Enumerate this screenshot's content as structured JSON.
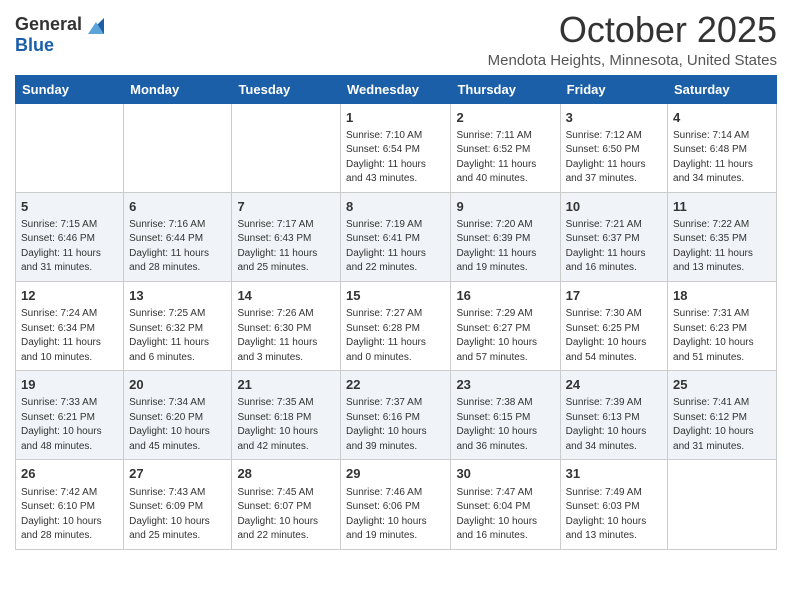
{
  "header": {
    "logo_general": "General",
    "logo_blue": "Blue",
    "month_title": "October 2025",
    "location": "Mendota Heights, Minnesota, United States"
  },
  "days_of_week": [
    "Sunday",
    "Monday",
    "Tuesday",
    "Wednesday",
    "Thursday",
    "Friday",
    "Saturday"
  ],
  "weeks": [
    [
      {
        "day": "",
        "info": ""
      },
      {
        "day": "",
        "info": ""
      },
      {
        "day": "",
        "info": ""
      },
      {
        "day": "1",
        "info": "Sunrise: 7:10 AM\nSunset: 6:54 PM\nDaylight: 11 hours\nand 43 minutes."
      },
      {
        "day": "2",
        "info": "Sunrise: 7:11 AM\nSunset: 6:52 PM\nDaylight: 11 hours\nand 40 minutes."
      },
      {
        "day": "3",
        "info": "Sunrise: 7:12 AM\nSunset: 6:50 PM\nDaylight: 11 hours\nand 37 minutes."
      },
      {
        "day": "4",
        "info": "Sunrise: 7:14 AM\nSunset: 6:48 PM\nDaylight: 11 hours\nand 34 minutes."
      }
    ],
    [
      {
        "day": "5",
        "info": "Sunrise: 7:15 AM\nSunset: 6:46 PM\nDaylight: 11 hours\nand 31 minutes."
      },
      {
        "day": "6",
        "info": "Sunrise: 7:16 AM\nSunset: 6:44 PM\nDaylight: 11 hours\nand 28 minutes."
      },
      {
        "day": "7",
        "info": "Sunrise: 7:17 AM\nSunset: 6:43 PM\nDaylight: 11 hours\nand 25 minutes."
      },
      {
        "day": "8",
        "info": "Sunrise: 7:19 AM\nSunset: 6:41 PM\nDaylight: 11 hours\nand 22 minutes."
      },
      {
        "day": "9",
        "info": "Sunrise: 7:20 AM\nSunset: 6:39 PM\nDaylight: 11 hours\nand 19 minutes."
      },
      {
        "day": "10",
        "info": "Sunrise: 7:21 AM\nSunset: 6:37 PM\nDaylight: 11 hours\nand 16 minutes."
      },
      {
        "day": "11",
        "info": "Sunrise: 7:22 AM\nSunset: 6:35 PM\nDaylight: 11 hours\nand 13 minutes."
      }
    ],
    [
      {
        "day": "12",
        "info": "Sunrise: 7:24 AM\nSunset: 6:34 PM\nDaylight: 11 hours\nand 10 minutes."
      },
      {
        "day": "13",
        "info": "Sunrise: 7:25 AM\nSunset: 6:32 PM\nDaylight: 11 hours\nand 6 minutes."
      },
      {
        "day": "14",
        "info": "Sunrise: 7:26 AM\nSunset: 6:30 PM\nDaylight: 11 hours\nand 3 minutes."
      },
      {
        "day": "15",
        "info": "Sunrise: 7:27 AM\nSunset: 6:28 PM\nDaylight: 11 hours\nand 0 minutes."
      },
      {
        "day": "16",
        "info": "Sunrise: 7:29 AM\nSunset: 6:27 PM\nDaylight: 10 hours\nand 57 minutes."
      },
      {
        "day": "17",
        "info": "Sunrise: 7:30 AM\nSunset: 6:25 PM\nDaylight: 10 hours\nand 54 minutes."
      },
      {
        "day": "18",
        "info": "Sunrise: 7:31 AM\nSunset: 6:23 PM\nDaylight: 10 hours\nand 51 minutes."
      }
    ],
    [
      {
        "day": "19",
        "info": "Sunrise: 7:33 AM\nSunset: 6:21 PM\nDaylight: 10 hours\nand 48 minutes."
      },
      {
        "day": "20",
        "info": "Sunrise: 7:34 AM\nSunset: 6:20 PM\nDaylight: 10 hours\nand 45 minutes."
      },
      {
        "day": "21",
        "info": "Sunrise: 7:35 AM\nSunset: 6:18 PM\nDaylight: 10 hours\nand 42 minutes."
      },
      {
        "day": "22",
        "info": "Sunrise: 7:37 AM\nSunset: 6:16 PM\nDaylight: 10 hours\nand 39 minutes."
      },
      {
        "day": "23",
        "info": "Sunrise: 7:38 AM\nSunset: 6:15 PM\nDaylight: 10 hours\nand 36 minutes."
      },
      {
        "day": "24",
        "info": "Sunrise: 7:39 AM\nSunset: 6:13 PM\nDaylight: 10 hours\nand 34 minutes."
      },
      {
        "day": "25",
        "info": "Sunrise: 7:41 AM\nSunset: 6:12 PM\nDaylight: 10 hours\nand 31 minutes."
      }
    ],
    [
      {
        "day": "26",
        "info": "Sunrise: 7:42 AM\nSunset: 6:10 PM\nDaylight: 10 hours\nand 28 minutes."
      },
      {
        "day": "27",
        "info": "Sunrise: 7:43 AM\nSunset: 6:09 PM\nDaylight: 10 hours\nand 25 minutes."
      },
      {
        "day": "28",
        "info": "Sunrise: 7:45 AM\nSunset: 6:07 PM\nDaylight: 10 hours\nand 22 minutes."
      },
      {
        "day": "29",
        "info": "Sunrise: 7:46 AM\nSunset: 6:06 PM\nDaylight: 10 hours\nand 19 minutes."
      },
      {
        "day": "30",
        "info": "Sunrise: 7:47 AM\nSunset: 6:04 PM\nDaylight: 10 hours\nand 16 minutes."
      },
      {
        "day": "31",
        "info": "Sunrise: 7:49 AM\nSunset: 6:03 PM\nDaylight: 10 hours\nand 13 minutes."
      },
      {
        "day": "",
        "info": ""
      }
    ]
  ]
}
